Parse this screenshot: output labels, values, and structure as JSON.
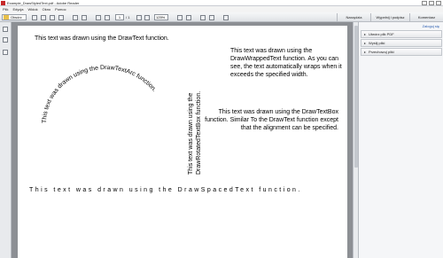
{
  "window": {
    "title": "Example_DrawStyledText.pdf - Adobe Reader"
  },
  "menu": [
    "Plik",
    "Edycja",
    "Widok",
    "Okno",
    "Pomoc"
  ],
  "toolbar": {
    "open_label": "Otwórz",
    "page_current": "1",
    "page_count": "/ 1",
    "zoom": "125%",
    "tools_label": "Narzędzia",
    "sign_label": "Wypełnij i podpisz",
    "comment_label": "Komentarz"
  },
  "document": {
    "drawtext": "This text was drawn using the DrawText function.",
    "arc_text": "This text was drawn using the DrawTextArc function.",
    "rotated_line1": "This text was drawn using the",
    "rotated_line2": "DrawRotatedTextBox function.",
    "wrapped_text": "This text was drawn using the DrawWrappedText function. As you can see, the text automatically wraps when it exceeds the specified width.",
    "box_text": "This text was drawn using the DrawTextBox function.  Similar To the DrawText function except that the alignment can be specified.",
    "spaced_text": "This text was drawn using the DrawSpacedText function."
  },
  "right_panel": {
    "link": "Zaloguj się",
    "items": [
      "Utwórz plik PDF",
      "Wyślij pliki",
      "Przechowuj pliki"
    ]
  }
}
